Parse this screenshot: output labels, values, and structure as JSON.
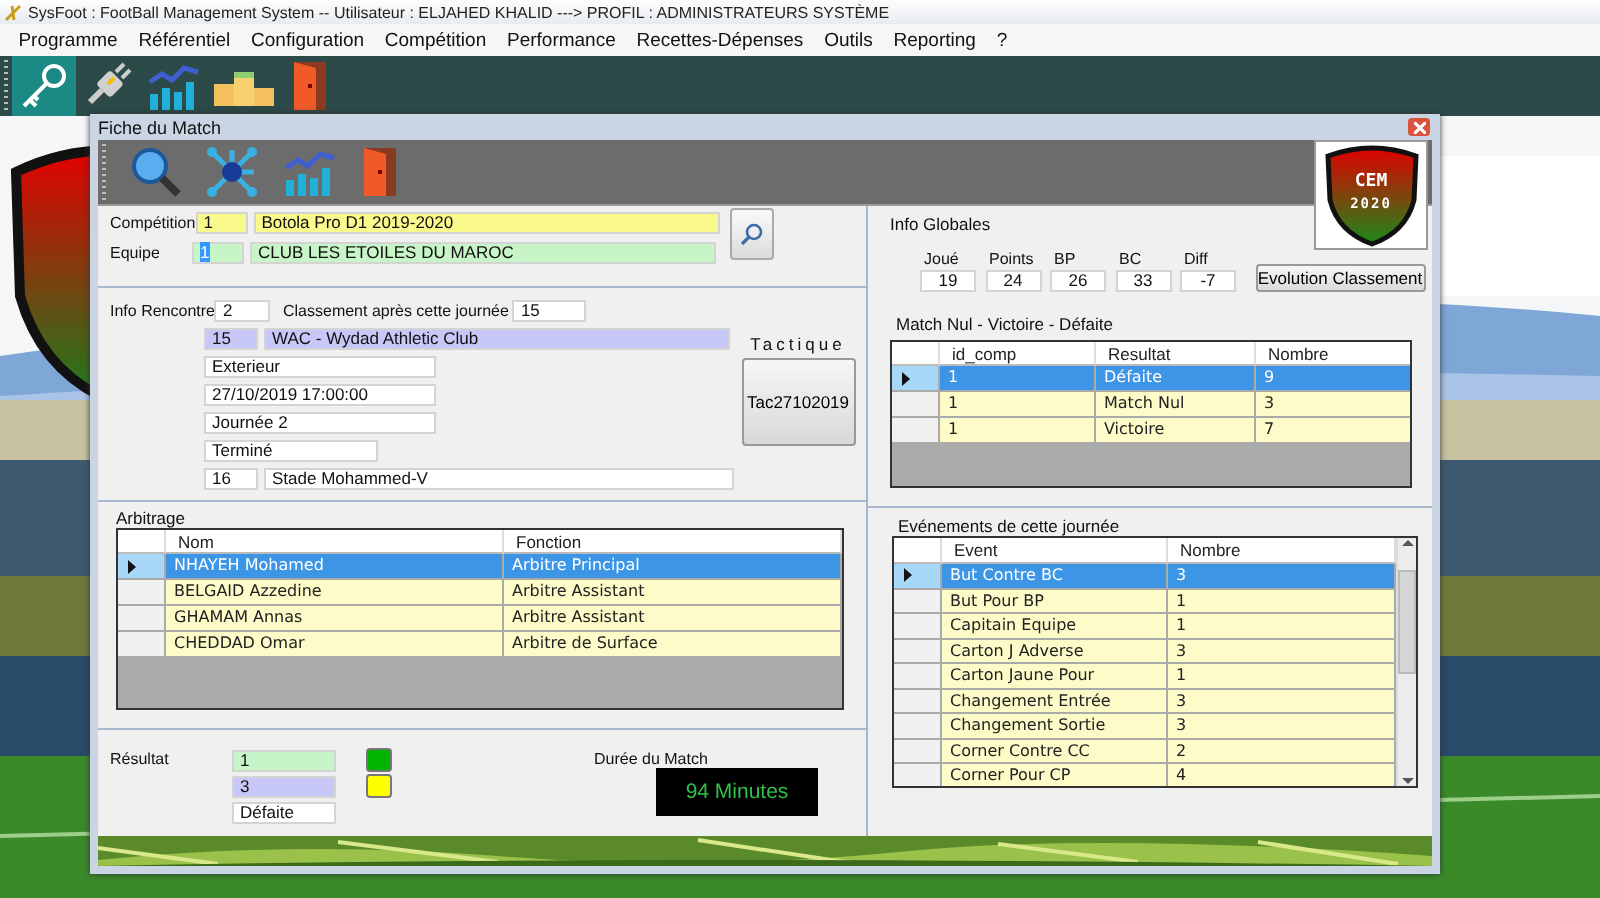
{
  "app": {
    "title": "SysFoot : FootBall Management System -- Utilisateur : ELJAHED KHALID ---> PROFIL : ADMINISTRATEURS SYSTÈME"
  },
  "menu": [
    "Programme",
    "Référentiel",
    "Configuration",
    "Compétition",
    "Performance",
    "Recettes-Dépenses",
    "Outils",
    "Reporting",
    "?"
  ],
  "toolbar": [
    {
      "selected": true
    },
    {
      "selected": false
    },
    {
      "selected": false
    },
    {
      "selected": false
    },
    {
      "selected": false
    }
  ],
  "dialog": {
    "title": "Fiche du Match"
  },
  "logo": {
    "title": "CEM",
    "year": "2020"
  },
  "competition": {
    "label": "Compétition",
    "id": "1",
    "name": "Botola Pro D1 2019-2020"
  },
  "equipe": {
    "label": "Equipe",
    "id": "1",
    "id_selected": true,
    "name": "CLUB LES ETOILES DU MAROC"
  },
  "rencontre": {
    "label": "Info Rencontre",
    "numero": "2",
    "classement_label": "Classement après cette journée",
    "classement": "15",
    "adversaire_id": "15",
    "adversaire": "WAC - Wydad Athletic Club",
    "lieu": "Exterieur",
    "date": "27/10/2019 17:00:00",
    "journee": "Journée 2",
    "statut": "Terminé",
    "stade_id": "16",
    "stade": "Stade Mohammed-V"
  },
  "tactique": {
    "label": "Tactique",
    "button": "Tac27102019"
  },
  "arbitrage": {
    "title": "Arbitrage",
    "columns": [
      "Nom",
      "Fonction"
    ],
    "rows": [
      {
        "cells": [
          "NHAYEH Mohamed",
          "Arbitre Principal"
        ],
        "selected": true
      },
      {
        "cells": [
          "BELGAID Azzedine",
          "Arbitre Assistant"
        ],
        "selected": false
      },
      {
        "cells": [
          "GHAMAM Annas",
          "Arbitre Assistant"
        ],
        "selected": false
      },
      {
        "cells": [
          "CHEDDAD Omar",
          "Arbitre de Surface"
        ],
        "selected": false
      }
    ]
  },
  "resultat": {
    "label": "Résultat",
    "buts_pour": "1",
    "buts_contre": "3",
    "issue": "Défaite",
    "swatches": [
      {
        "color": "#00b400"
      },
      {
        "color": "#ffff00"
      }
    ]
  },
  "duree": {
    "label": "Durée du Match",
    "value": "94 Minutes"
  },
  "info_globales": {
    "title": "Info Globales",
    "stats": [
      {
        "label": "Joué",
        "value": "19"
      },
      {
        "label": "Points",
        "value": "24"
      },
      {
        "label": "BP",
        "value": "26"
      },
      {
        "label": "BC",
        "value": "33"
      },
      {
        "label": "Diff",
        "value": "-7"
      }
    ],
    "button": "Evolution Classement"
  },
  "bilan": {
    "title": "Match Nul - Victoire - Défaite",
    "columns": [
      "id_comp",
      "Resultat",
      "Nombre"
    ],
    "rows": [
      {
        "cells": [
          "1",
          "Défaite",
          "9"
        ],
        "selected": true
      },
      {
        "cells": [
          "1",
          "Match Nul",
          "3"
        ],
        "selected": false
      },
      {
        "cells": [
          "1",
          "Victoire",
          "7"
        ],
        "selected": false
      }
    ]
  },
  "evenements": {
    "title": "Evénements de cette journée",
    "columns": [
      "Event",
      "Nombre"
    ],
    "rows": [
      {
        "cells": [
          "But Contre BC",
          "3"
        ],
        "selected": true
      },
      {
        "cells": [
          "But Pour BP",
          "1"
        ],
        "selected": false
      },
      {
        "cells": [
          "Capitain Equipe",
          "1"
        ],
        "selected": false
      },
      {
        "cells": [
          "Carton J Adverse",
          "3"
        ],
        "selected": false
      },
      {
        "cells": [
          "Carton Jaune Pour",
          "1"
        ],
        "selected": false
      },
      {
        "cells": [
          "Changement Entrée",
          "3"
        ],
        "selected": false
      },
      {
        "cells": [
          "Changement Sortie",
          "3"
        ],
        "selected": false
      },
      {
        "cells": [
          "Corner Contre CC",
          "2"
        ],
        "selected": false
      },
      {
        "cells": [
          "Corner Pour CP",
          "4"
        ],
        "selected": false
      }
    ]
  }
}
